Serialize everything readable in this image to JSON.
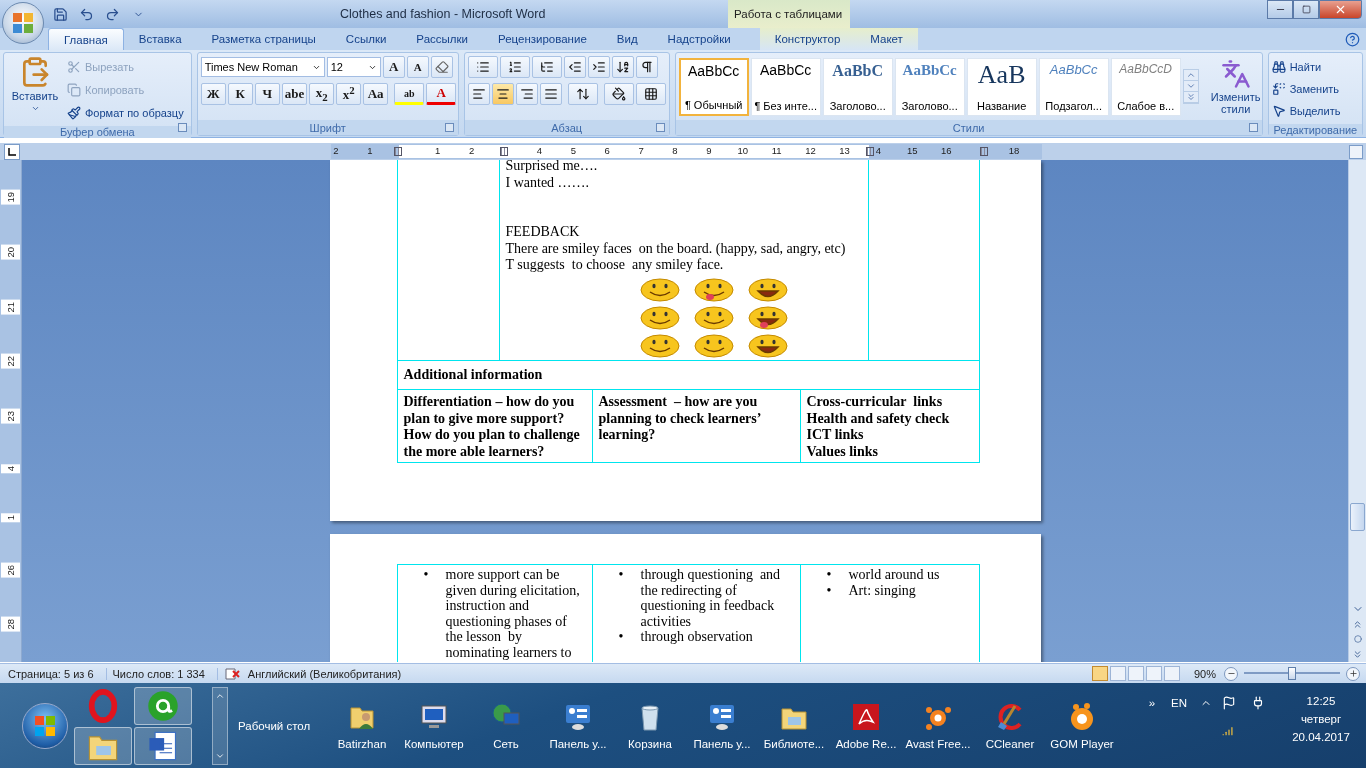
{
  "window": {
    "title": "Clothes and fashion - Microsoft Word",
    "context_title": "Работа с таблицами"
  },
  "tabs": [
    {
      "label": "Главная",
      "selected": true,
      "contextual": false
    },
    {
      "label": "Вставка",
      "selected": false,
      "contextual": false
    },
    {
      "label": "Разметка страницы",
      "selected": false,
      "contextual": false
    },
    {
      "label": "Ссылки",
      "selected": false,
      "contextual": false
    },
    {
      "label": "Рассылки",
      "selected": false,
      "contextual": false
    },
    {
      "label": "Рецензирование",
      "selected": false,
      "contextual": false
    },
    {
      "label": "Вид",
      "selected": false,
      "contextual": false
    },
    {
      "label": "Надстройки",
      "selected": false,
      "contextual": false
    },
    {
      "label": "Конструктор",
      "selected": false,
      "contextual": true
    },
    {
      "label": "Макет",
      "selected": false,
      "contextual": true
    }
  ],
  "clipboard": {
    "paste": "Вставить",
    "group": "Буфер обмена",
    "items": [
      {
        "kind": "cut",
        "label": "Вырезать",
        "disabled": true
      },
      {
        "kind": "copy",
        "label": "Копировать",
        "disabled": true
      },
      {
        "kind": "format",
        "label": "Формат по образцу",
        "disabled": false
      }
    ]
  },
  "font": {
    "name": "Times New Roman",
    "size": "12",
    "grow": "A",
    "shrink": "A",
    "buttons": [
      "Ж",
      "К",
      "Ч",
      "abe",
      "x$_{2}$",
      "x$^{2}$",
      "Aa"
    ],
    "highlight_glyph": "ab",
    "font_color_glyph": "A",
    "group": "Шрифт"
  },
  "paragraph": {
    "group": "Абзац",
    "align": [
      {
        "kind": "left",
        "selected": false
      },
      {
        "kind": "center",
        "selected": true
      },
      {
        "kind": "right",
        "selected": false
      },
      {
        "kind": "justify",
        "selected": false
      }
    ]
  },
  "styles": {
    "group": "Стили",
    "change": "Изменить стили",
    "items": [
      {
        "kind": "normal",
        "preview": "AaBbCc",
        "name": "¶ Обычный",
        "selected": true
      },
      {
        "kind": "normal",
        "preview": "AaBbCc",
        "name": "¶ Без инте...",
        "selected": false
      },
      {
        "kind": "heading1",
        "preview": "AaBbC",
        "name": "Заголово...",
        "selected": false
      },
      {
        "kind": "heading2",
        "preview": "AaBbCc",
        "name": "Заголово...",
        "selected": false
      },
      {
        "kind": "title",
        "preview": "AaB",
        "name": "Название",
        "selected": false
      },
      {
        "kind": "subtitle",
        "preview": "AaBbCc",
        "name": "Подзагол...",
        "selected": false
      },
      {
        "kind": "subtle",
        "preview": "AaBbCcD",
        "name": "Слабое в...",
        "selected": false
      }
    ]
  },
  "editing": {
    "group": "Редактирование",
    "items": [
      {
        "kind": "find",
        "label": "Найти"
      },
      {
        "kind": "replace",
        "label": "Заменить"
      },
      {
        "kind": "select",
        "label": "Выделить"
      }
    ]
  },
  "ruler": {
    "labels": [
      "2",
      "1",
      "1",
      "2",
      "4",
      "5",
      "6",
      "7",
      "8",
      "9",
      "10",
      "11",
      "12",
      "13",
      "4",
      "15",
      "16",
      "18"
    ]
  },
  "vertical_ruler": {
    "labels": [
      "19",
      "20",
      "21",
      "22",
      "23",
      "4",
      "1",
      "26",
      "28"
    ]
  },
  "page_1": {
    "activity_lines": [
      "Surprised me….",
      "I wanted ……."
    ],
    "feedback_heading": "FEEDBACK",
    "feedback_lines": [
      "There are smiley faces  on the board. (happy, sad, angry, etc)",
      "T suggests  to choose  any smiley face."
    ],
    "additional": "Additional information",
    "headers": [
      [
        "Differentiation – how do you plan to give more support? How do you plan to challenge the more able learners?"
      ],
      [
        "Assessment  – how are you planning to check learners’ learning?"
      ],
      [
        "Cross-curricular  links",
        "Health and safety check",
        "ICT links",
        "Values links"
      ]
    ]
  },
  "page_2": {
    "columns": [
      [
        {
          "marker": "•",
          "text": "more support can be given during elicitation, instruction and questioning phases of the lesson  by nominating learners to"
        }
      ],
      [
        {
          "marker": "•",
          "text": "through questioning  and the redirecting of questioning in feedback activities"
        },
        {
          "marker": "•",
          "text": "through observation"
        }
      ],
      [
        {
          "marker": "•",
          "text": "world around us"
        },
        {
          "marker": "•",
          "text": "Art: singing"
        }
      ]
    ]
  },
  "status_bar": {
    "page": "Страница: 5 из 6",
    "words": "Число слов: 1 334",
    "language": "Английский (Великобритания)",
    "views": [
      {
        "selected": true
      },
      {
        "selected": false
      },
      {
        "selected": false
      },
      {
        "selected": false
      },
      {
        "selected": false
      }
    ],
    "zoom": "90%",
    "zoom_slider": {
      "level": 0.5
    }
  },
  "taskbar": {
    "quick_launch": [
      {
        "kind": "opera"
      },
      {
        "kind": "agent"
      },
      {
        "kind": "explorer"
      },
      {
        "kind": "word"
      }
    ],
    "toolbar_label": "Рабочий стол",
    "items": [
      {
        "kind": "user",
        "label": "Batirzhan"
      },
      {
        "kind": "computer",
        "label": "Компьютер"
      },
      {
        "kind": "network",
        "label": "Сеть"
      },
      {
        "kind": "control",
        "label": "Панель у..."
      },
      {
        "kind": "trash",
        "label": "Корзина"
      },
      {
        "kind": "control",
        "label": "Панель у..."
      },
      {
        "kind": "library",
        "label": "Библиоте..."
      },
      {
        "kind": "pdf",
        "label": "Adobe Re..."
      },
      {
        "kind": "avast",
        "label": "Avast Free..."
      },
      {
        "kind": "ccleaner",
        "label": "CCleaner"
      },
      {
        "kind": "gom",
        "label": "GOM Player"
      }
    ],
    "chevron": "»",
    "lang": "EN",
    "time": "12:25",
    "day": "четверг",
    "date": "20.04.2017"
  }
}
